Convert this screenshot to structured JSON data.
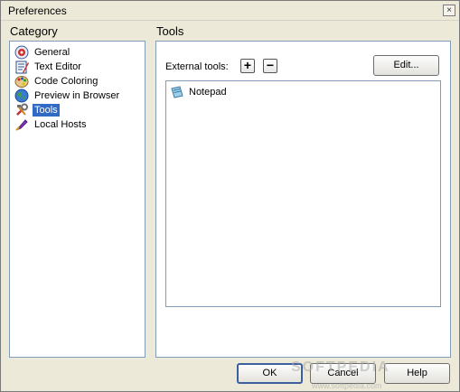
{
  "window": {
    "title": "Preferences",
    "close_glyph": "×"
  },
  "category": {
    "heading": "Category",
    "items": [
      {
        "label": "General",
        "icon": "general-icon"
      },
      {
        "label": "Text Editor",
        "icon": "text-editor-icon"
      },
      {
        "label": "Code Coloring",
        "icon": "palette-icon"
      },
      {
        "label": "Preview in Browser",
        "icon": "globe-icon"
      },
      {
        "label": "Tools",
        "icon": "tools-icon",
        "selected": true
      },
      {
        "label": "Local Hosts",
        "icon": "local-hosts-icon"
      }
    ]
  },
  "tools": {
    "heading": "Tools",
    "external_label": "External tools:",
    "add_glyph": "+",
    "remove_glyph": "−",
    "edit_label": "Edit...",
    "list": [
      {
        "label": "Notepad",
        "icon": "notepad-icon"
      }
    ]
  },
  "buttons": {
    "ok": "OK",
    "cancel": "Cancel",
    "help": "Help"
  },
  "watermark": {
    "text": "SOFTPEDIA",
    "url": "www.softpedia.com"
  },
  "colors": {
    "selection": "#316ac5",
    "panel_border": "#7f9db9",
    "dialog_bg": "#ece9d8"
  }
}
